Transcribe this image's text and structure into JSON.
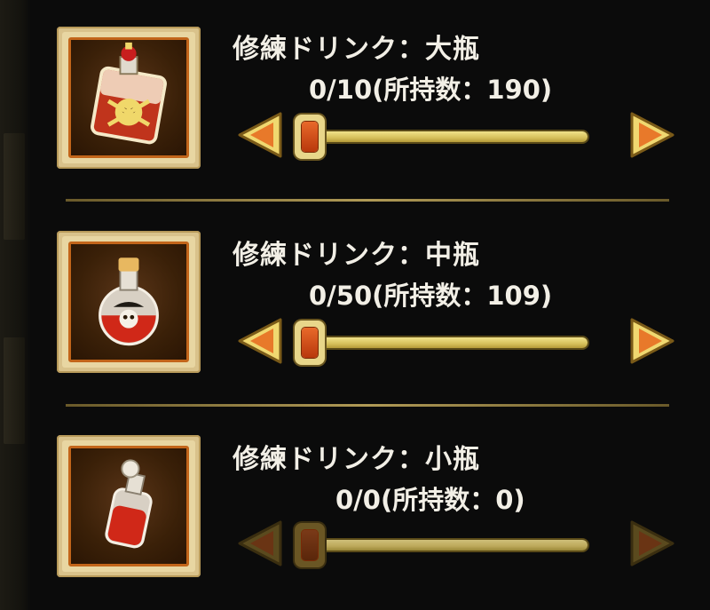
{
  "items": [
    {
      "title": "修練ドリンク：大瓶",
      "count": "0/10(所持数：190)",
      "enabled": true,
      "icon": "large-bottle-icon"
    },
    {
      "title": "修練ドリンク：中瓶",
      "count": "0/50(所持数：109)",
      "enabled": true,
      "icon": "medium-flask-icon"
    },
    {
      "title": "修練ドリンク：小瓶",
      "count": "0/0(所持数：0)",
      "enabled": false,
      "icon": "small-vial-icon"
    }
  ],
  "colors": {
    "text": "#f2efe6",
    "accent_orange": "#e8692a",
    "frame_gold": "#d9c28b",
    "track_gold": "#d6c05a"
  }
}
